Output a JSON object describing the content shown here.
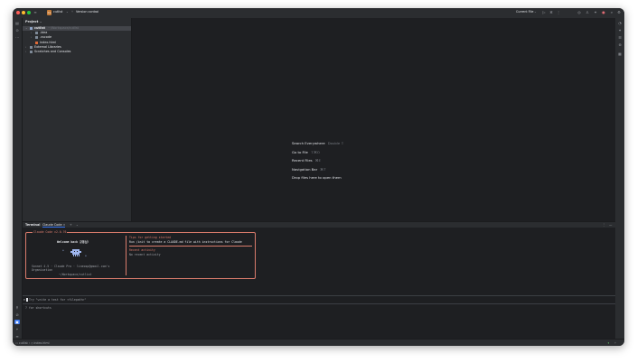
{
  "colors": {
    "accent": "#3574f0",
    "claude": "#d97b6c",
    "close": "#ff5f57",
    "minimize": "#febc2e",
    "maximize": "#28c840"
  },
  "titlebar": {
    "project_badge": "CL",
    "project_name": "cutlist",
    "vcs_label": "Version control",
    "run_config": "Current File"
  },
  "project_pane": {
    "title": "Project",
    "tree": [
      {
        "label": "cutlist",
        "extra": "~/Workspace/cutlist",
        "depth": 1,
        "expanded": true,
        "selected": true
      },
      {
        "label": ".idea",
        "depth": 2,
        "expanded": false
      },
      {
        "label": ".vscode",
        "depth": 2,
        "expanded": false
      },
      {
        "label": "index.html",
        "depth": 2
      },
      {
        "label": "External Libraries",
        "depth": 1,
        "expanded": false
      },
      {
        "label": "Scratches and Consoles",
        "depth": 1,
        "expanded": false
      }
    ]
  },
  "editor": {
    "hints": [
      {
        "label": "Search Everywhere",
        "key": "Double ⇧"
      },
      {
        "label": "Go to File",
        "key": "⇧⌘O"
      },
      {
        "label": "Recent Files",
        "key": "⌘E"
      },
      {
        "label": "Navigation Bar",
        "key": "⌘↑"
      },
      {
        "label": "Drop files here to open them",
        "key": ""
      }
    ]
  },
  "terminal": {
    "tabs": [
      "Terminal",
      "Claude Code"
    ],
    "claude": {
      "box_title": "Claude Code v2.0.76",
      "welcome": "Welcome back 규동님!",
      "model_line": "Sonnet 4.5 · Claude Pro · lineosp@gmail.com's",
      "org_line": "Organization",
      "cwd": "~/Workspace/cutlist",
      "tips_title": "Tips for getting started",
      "tips_body": "Run /init to create a CLAUDE.md file with instructions for Claude",
      "recent_title": "Recent activity",
      "recent_body": "No recent activity"
    },
    "prompt_symbol": ">",
    "prompt_text": "Try \"write a test for <filepath>\"",
    "shortcuts_hint": "? for shortcuts"
  },
  "statusbar": {
    "breadcrumb": [
      "cutlist",
      "index.html"
    ]
  }
}
